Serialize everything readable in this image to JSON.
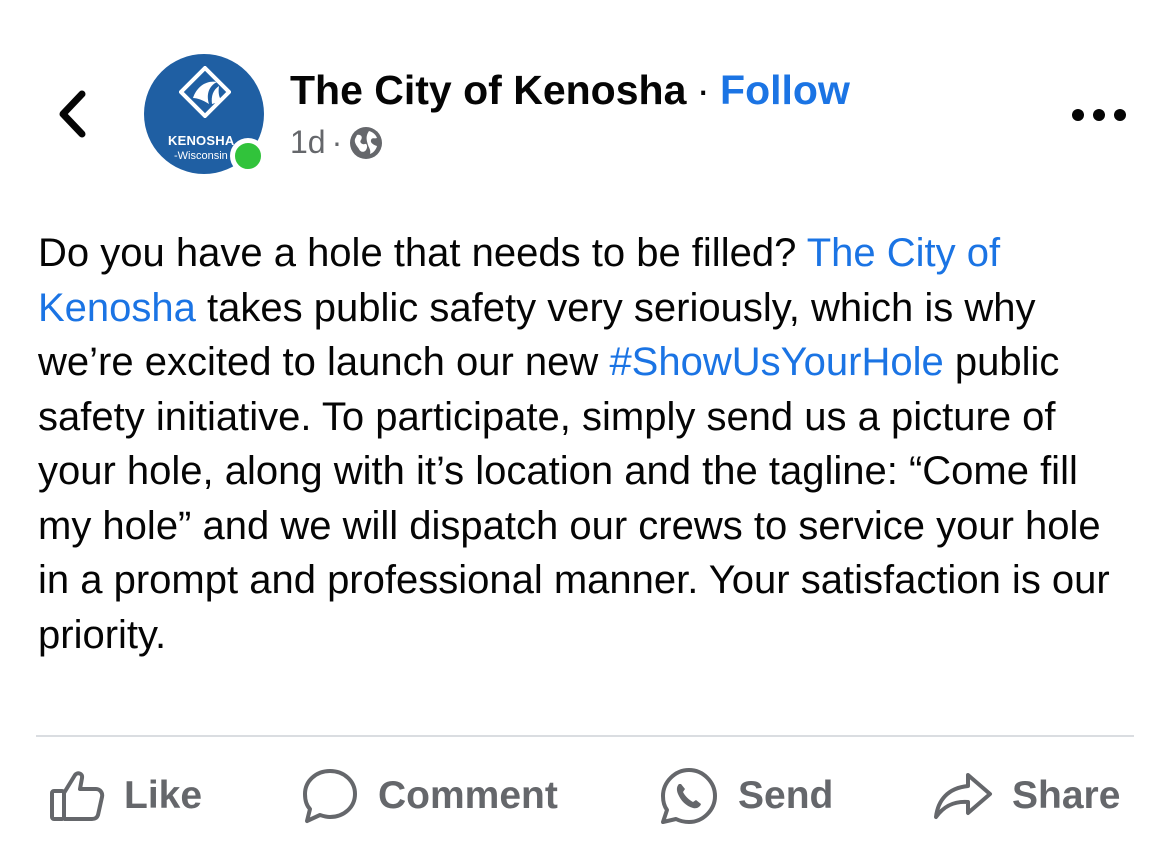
{
  "header": {
    "avatar_text_line1": "KENOSHA",
    "avatar_text_line2": "-Wisconsin",
    "page_name": "The City of Kenosha",
    "separator": "·",
    "follow_label": "Follow",
    "timestamp": "1d",
    "meta_separator": "·",
    "privacy_icon": "globe-icon",
    "back_icon": "chevron-left-icon",
    "more_icon": "more-horizontal-icon"
  },
  "post": {
    "segments": [
      {
        "text": "Do you have a hole that needs to be filled?  ",
        "link": false
      },
      {
        "text": "The City of Kenosha",
        "link": true
      },
      {
        "text": " takes public safety  very seriously, which is why we’re excited to launch our  new ",
        "link": false
      },
      {
        "text": "#ShowUsYourHole",
        "link": true
      },
      {
        "text": " public safety initiative.  To participate, simply send us a picture of your hole, along with it’s location and the tagline: “Come fill my hole” and we will dispatch our crews to service your hole in a prompt and professional manner.  Your satisfaction is our priority.",
        "link": false
      }
    ]
  },
  "actions": {
    "like_label": "Like",
    "comment_label": "Comment",
    "send_label": "Send",
    "share_label": "Share"
  },
  "colors": {
    "accent": "#1b74e4",
    "avatar_bg": "#1f5fa3",
    "online": "#31c33b",
    "secondary_text": "#65676b"
  }
}
